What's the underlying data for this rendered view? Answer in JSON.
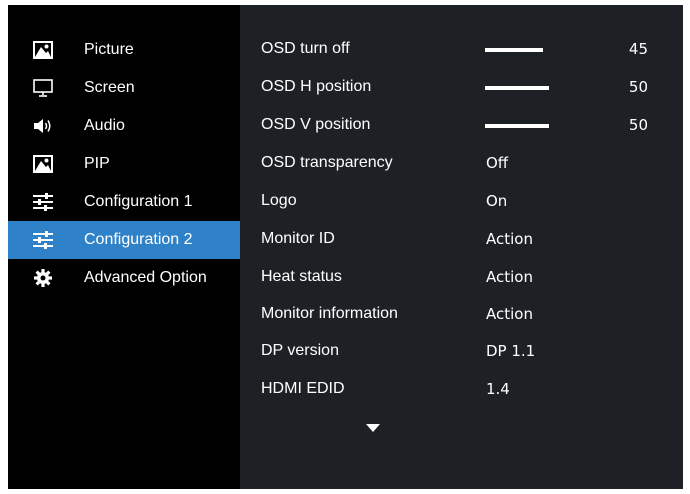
{
  "sidebar": {
    "items": [
      {
        "label": "Picture",
        "icon": "picture-icon",
        "active": false
      },
      {
        "label": "Screen",
        "icon": "monitor-icon",
        "active": false
      },
      {
        "label": "Audio",
        "icon": "speaker-icon",
        "active": false
      },
      {
        "label": "PIP",
        "icon": "picture-icon",
        "active": false
      },
      {
        "label": "Configuration 1",
        "icon": "sliders-icon",
        "active": false
      },
      {
        "label": "Configuration 2",
        "icon": "sliders-icon",
        "active": true
      },
      {
        "label": "Advanced Option",
        "icon": "gear-icon",
        "active": false
      }
    ]
  },
  "settings": [
    {
      "name": "OSD turn off",
      "value": "45",
      "level": 0.45
    },
    {
      "name": "OSD H position",
      "value": "50",
      "level": 0.5
    },
    {
      "name": "OSD V position",
      "value": "50",
      "level": 0.5
    },
    {
      "name": "OSD transparency",
      "value": "Off"
    },
    {
      "name": "Logo",
      "value": "On"
    },
    {
      "name": "Monitor ID",
      "value": "Action"
    },
    {
      "name": "Heat status",
      "value": "Action"
    },
    {
      "name": "Monitor information",
      "value": "Action"
    },
    {
      "name": "DP version",
      "value": "DP 1.1"
    },
    {
      "name": "HDMI EDID",
      "value": "1.4"
    }
  ],
  "more_indicator": "scroll-down-arrow-icon",
  "colors": {
    "highlight": "#2f82c8",
    "panel": "#1d2125",
    "background": "#000000",
    "text": "#ffffff"
  }
}
